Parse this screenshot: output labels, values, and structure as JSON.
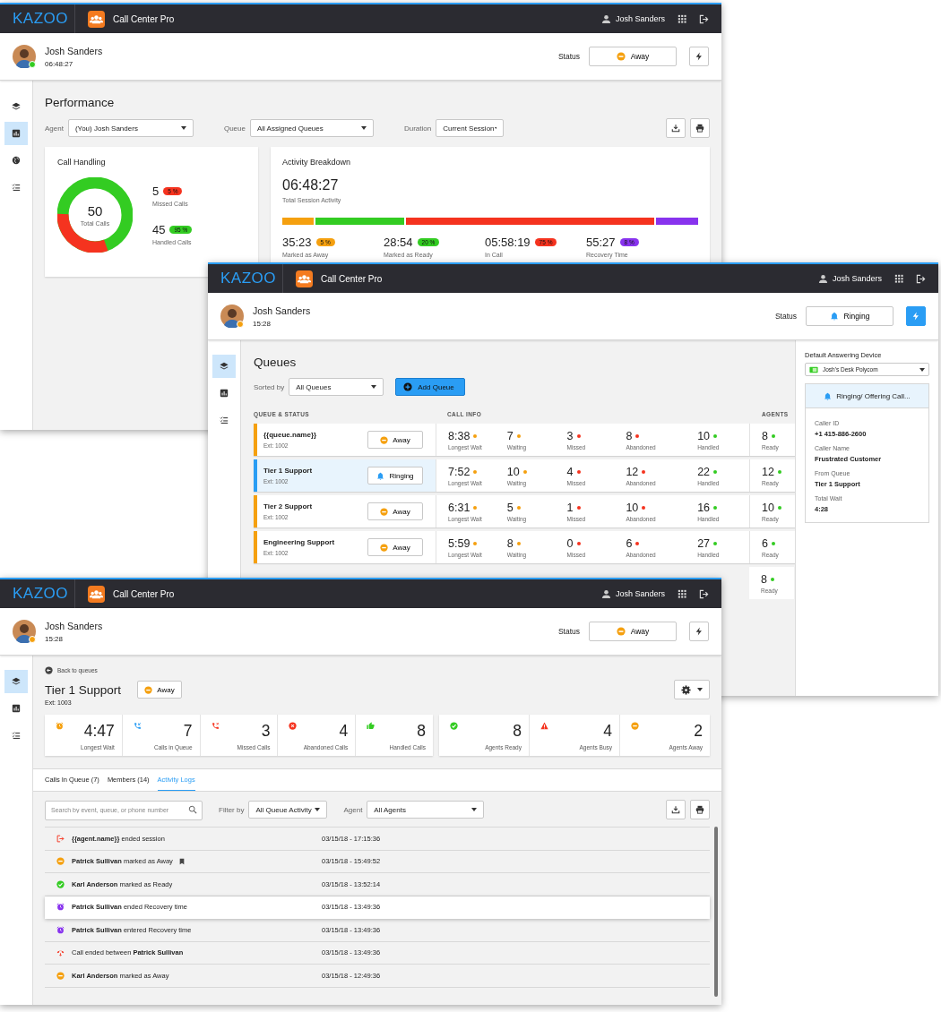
{
  "windows": [
    {
      "kind": "performance",
      "header": {
        "logo": "KAZOO",
        "app": "Call Center Pro",
        "user": "Josh Sanders"
      },
      "agent": {
        "name": "Josh Sanders",
        "time": "06:48:27",
        "color": "#33cc22"
      },
      "status": {
        "label": "Status",
        "value": "Away",
        "kind": "away"
      },
      "quick_action": {
        "active": false
      },
      "sidebar": [
        {
          "kind": "layers",
          "selected": false
        },
        {
          "kind": "chart",
          "selected": true
        },
        {
          "kind": "globe",
          "selected": false
        },
        {
          "kind": "checklist",
          "selected": false
        }
      ],
      "title": "Performance",
      "filters": [
        {
          "label": "Agent",
          "value": "(You) Josh Sanders"
        },
        {
          "label": "Queue",
          "value": "All Assigned Queues"
        },
        {
          "label": "Duration",
          "value": "Current Session"
        }
      ],
      "call_handling": {
        "title": "Call Handling",
        "total": "50",
        "total_label": "Total Calls",
        "stats": [
          {
            "value": "5",
            "badge": "5 %",
            "color": "#f5331f",
            "label": "Missed Calls"
          },
          {
            "value": "45",
            "badge": "95 %",
            "color": "#33cc22",
            "label": "Handled Calls"
          }
        ]
      },
      "activity": {
        "title": "Activity Breakdown",
        "total": "06:48:27",
        "total_label": "Total Session Activity",
        "stats": [
          {
            "value": "35:23",
            "badge": "5 %",
            "color": "#f5a00f",
            "label": "Marked as Away"
          },
          {
            "value": "28:54",
            "badge": "20 %",
            "color": "#33cc22",
            "label": "Marked as Ready"
          },
          {
            "value": "05:58:19",
            "badge": "75 %",
            "color": "#f5331f",
            "label": "In Call"
          },
          {
            "value": "55:27",
            "badge": "8 %",
            "color": "#8833ee",
            "label": "Recovery Time"
          }
        ]
      }
    },
    {
      "kind": "queues",
      "header": {
        "logo": "KAZOO",
        "app": "Call Center Pro",
        "user": "Josh Sanders"
      },
      "agent": {
        "name": "Josh Sanders",
        "time": "15:28",
        "color": "#f5a00f"
      },
      "status": {
        "label": "Status",
        "value": "Ringing",
        "kind": "ringing"
      },
      "quick_action": {
        "active": true
      },
      "sidebar": [
        {
          "kind": "layers",
          "selected": true
        },
        {
          "kind": "chart",
          "selected": false
        },
        {
          "kind": "checklist",
          "selected": false
        }
      ],
      "title": "Queues",
      "sort": {
        "label": "Sorted by",
        "value": "All Queues"
      },
      "add_button": "Add Queue",
      "columns": [
        "QUEUE & STATUS",
        "CALL INFO",
        "AGENTS"
      ],
      "rows": [
        {
          "name": "{{queue.name}}",
          "ext": "Ext: 1002",
          "color": "#f5a00f",
          "selected": false,
          "status": {
            "kind": "away",
            "label": "Away"
          },
          "cells": [
            {
              "value": "8:38",
              "label": "Longest Wait",
              "color": "#f5a00f"
            },
            {
              "value": "7",
              "label": "Waiting",
              "color": "#f5a00f"
            },
            {
              "value": "3",
              "label": "Missed",
              "color": "#f5331f"
            },
            {
              "value": "8",
              "label": "Abandoned",
              "color": "#f5331f"
            },
            {
              "value": "10",
              "label": "Handled",
              "color": "#33cc22"
            }
          ],
          "agents": {
            "value": "8",
            "label": "Ready",
            "color": "#33cc22"
          }
        },
        {
          "name": "Tier 1 Support",
          "ext": "Ext: 1002",
          "color": "#2a9df4",
          "selected": true,
          "status": {
            "kind": "ringing",
            "label": "Ringing"
          },
          "cells": [
            {
              "value": "7:52",
              "label": "Longest Wait",
              "color": "#f5a00f"
            },
            {
              "value": "10",
              "label": "Waiting",
              "color": "#f5a00f"
            },
            {
              "value": "4",
              "label": "Missed",
              "color": "#f5331f"
            },
            {
              "value": "12",
              "label": "Abandoned",
              "color": "#f5331f"
            },
            {
              "value": "22",
              "label": "Handled",
              "color": "#33cc22"
            }
          ],
          "agents": {
            "value": "12",
            "label": "Ready",
            "color": "#33cc22"
          }
        },
        {
          "name": "Tier 2 Support",
          "ext": "Ext: 1002",
          "color": "#f5a00f",
          "selected": false,
          "status": {
            "kind": "away",
            "label": "Away"
          },
          "cells": [
            {
              "value": "6:31",
              "label": "Longest Wait",
              "color": "#f5a00f"
            },
            {
              "value": "5",
              "label": "Waiting",
              "color": "#f5a00f"
            },
            {
              "value": "1",
              "label": "Missed",
              "color": "#f5331f"
            },
            {
              "value": "10",
              "label": "Abandoned",
              "color": "#f5331f"
            },
            {
              "value": "16",
              "label": "Handled",
              "color": "#33cc22"
            }
          ],
          "agents": {
            "value": "10",
            "label": "Ready",
            "color": "#33cc22"
          }
        },
        {
          "name": "Engineering Support",
          "ext": "Ext: 1002",
          "color": "#f5a00f",
          "selected": false,
          "status": {
            "kind": "away",
            "label": "Away"
          },
          "cells": [
            {
              "value": "5:59",
              "label": "Longest Wait",
              "color": "#f5a00f"
            },
            {
              "value": "8",
              "label": "Waiting",
              "color": "#f5a00f"
            },
            {
              "value": "0",
              "label": "Missed",
              "color": "#f5331f"
            },
            {
              "value": "6",
              "label": "Abandoned",
              "color": "#f5331f"
            },
            {
              "value": "27",
              "label": "Handled",
              "color": "#33cc22"
            }
          ],
          "agents": {
            "value": "6",
            "label": "Ready",
            "color": "#33cc22"
          }
        },
        {
          "selected": false,
          "agents": {
            "value": "8",
            "label": "Ready",
            "color": "#33cc22"
          }
        }
      ],
      "panel": {
        "device_label": "Default Answering Device",
        "device": "Josh's Desk Polycom",
        "call": {
          "kind": "ringing",
          "title": "Ringing/ Offering Call...",
          "fields": [
            {
              "label": "Caller ID",
              "value": "+1 415-886-2600"
            },
            {
              "label": "Caller Name",
              "value": "Frustrated Customer"
            },
            {
              "label": "From Queue",
              "value": "Tier 1 Support"
            },
            {
              "label": "Total Wait",
              "value": "4:28"
            }
          ]
        }
      }
    },
    {
      "kind": "queue_detail",
      "header": {
        "logo": "KAZOO",
        "app": "Call Center Pro",
        "user": "Josh Sanders"
      },
      "agent": {
        "name": "Josh Sanders",
        "time": "15:28",
        "color": "#f5a00f"
      },
      "status": {
        "label": "Status",
        "value": "Away",
        "kind": "away"
      },
      "quick_action": {
        "active": false
      },
      "sidebar": [
        {
          "kind": "layers",
          "selected": true
        },
        {
          "kind": "chart",
          "selected": false
        },
        {
          "kind": "checklist",
          "selected": false
        }
      ],
      "back": "Back to queues",
      "title": "Tier 1 Support",
      "queue_status": {
        "kind": "away",
        "label": "Away"
      },
      "ext": "Ext: 1003",
      "stat_groups": [
        [
          {
            "kind": "alarm",
            "value": "4:47",
            "label": "Longest Wait"
          },
          {
            "kind": "incoming",
            "value": "7",
            "label": "Calls in Queue"
          },
          {
            "kind": "missed",
            "value": "3",
            "label": "Missed Calls"
          },
          {
            "kind": "abandoned",
            "value": "4",
            "label": "Abandoned Calls"
          },
          {
            "kind": "handled",
            "value": "8",
            "label": "Handled Calls"
          }
        ],
        [
          {
            "kind": "ready",
            "value": "8",
            "label": "Agents Ready"
          },
          {
            "kind": "busy",
            "value": "4",
            "label": "Agents Busy"
          },
          {
            "kind": "away",
            "value": "2",
            "label": "Agents Away"
          }
        ]
      ],
      "tabs": [
        {
          "label": "Calls In Queue (7)",
          "selected": false
        },
        {
          "label": "Members (14)",
          "selected": false
        },
        {
          "label": "Activity Logs",
          "selected": true
        }
      ],
      "search": {
        "placeholder": "Search by event, queue, or phone number"
      },
      "filters": [
        {
          "label": "Filter by",
          "value": "All Queue Activity"
        },
        {
          "label": "Agent",
          "value": "All Agents"
        }
      ],
      "logs": [
        {
          "kind": "logout",
          "text": "**{{agent.name}}** ended session",
          "time": "03/15/18 - 17:15:36",
          "bookmarked": false,
          "selected": false
        },
        {
          "kind": "away",
          "text": "**Patrick Sullivan** marked as Away",
          "time": "03/15/18 - 15:49:52",
          "bookmarked": true,
          "selected": false
        },
        {
          "kind": "ready",
          "text": "**Karl Anderson** marked as Ready",
          "time": "03/15/18 - 13:52:14",
          "bookmarked": false,
          "selected": false
        },
        {
          "kind": "recovery",
          "text": "**Patrick Sullivan** ended Recovery time",
          "time": "03/15/18 - 13:49:36",
          "bookmarked": false,
          "selected": true
        },
        {
          "kind": "recovery",
          "text": "**Patrick Sullivan** entered Recovery time",
          "time": "03/15/18 - 13:49:36",
          "bookmarked": false,
          "selected": false
        },
        {
          "kind": "hangup",
          "text": "Call ended between **Patrick Sullivan**",
          "time": "03/15/18 - 13:49:36",
          "bookmarked": false,
          "selected": false
        },
        {
          "kind": "away",
          "text": "**Karl Anderson** marked as Away",
          "time": "03/15/18 - 12:49:36",
          "bookmarked": false,
          "selected": false
        }
      ]
    }
  ]
}
